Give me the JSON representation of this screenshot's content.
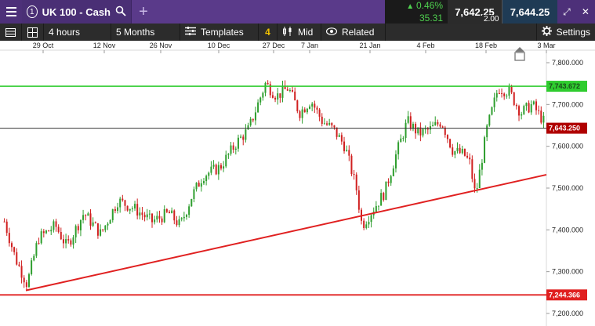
{
  "topbar": {
    "index_badge": "1",
    "instrument": "UK 100 - Cash",
    "change_pct": "0.46%",
    "change_pts": "35.31",
    "sell_price": "7,642.25",
    "buy_price": "7,644.25",
    "spread": "2.00",
    "colors": {
      "bg": "#5a3a8a",
      "up": "#4fd14f"
    }
  },
  "toolbar": {
    "interval": "4 hours",
    "range": "5 Months",
    "templates_label": "Templates",
    "templates_count": "4",
    "price_type": "Mid",
    "related_label": "Related",
    "settings_label": "Settings"
  },
  "chart": {
    "x_labels": [
      "29 Oct",
      "12 Nov",
      "26 Nov",
      "10 Dec",
      "27 Dec",
      "7 Jan",
      "21 Jan",
      "4 Feb",
      "18 Feb",
      "3 Mar"
    ],
    "y_labels": [
      "7,800.000",
      "7,700.000",
      "7,600.000",
      "7,500.000",
      "7,400.000",
      "7,300.000",
      "7,200.000"
    ],
    "resistance_tag": "7,743.672",
    "current_tag": "7,643.250",
    "support_tag": "7,244.366",
    "colors": {
      "up": "#2e9e2e",
      "down": "#d02020",
      "resistance": "#2ecc2e",
      "trend": "#e02020",
      "current": "#b00000"
    }
  },
  "chart_data": {
    "type": "candlestick",
    "instrument": "UK 100 - Cash",
    "interval": "4 hours",
    "ylim": [
      7180,
      7840
    ],
    "y_ticks": [
      7200,
      7300,
      7400,
      7500,
      7600,
      7700,
      7800
    ],
    "x_ticks": [
      "29 Oct",
      "12 Nov",
      "26 Nov",
      "10 Dec",
      "27 Dec",
      "7 Jan",
      "21 Jan",
      "4 Feb",
      "18 Feb",
      "3 Mar"
    ],
    "path": [
      [
        0,
        7420
      ],
      [
        0.02,
        7330
      ],
      [
        0.04,
        7270
      ],
      [
        0.06,
        7380
      ],
      [
        0.09,
        7410
      ],
      [
        0.11,
        7360
      ],
      [
        0.14,
        7440
      ],
      [
        0.17,
        7390
      ],
      [
        0.2,
        7470
      ],
      [
        0.23,
        7450
      ],
      [
        0.26,
        7420
      ],
      [
        0.29,
        7440
      ],
      [
        0.31,
        7410
      ],
      [
        0.33,
        7480
      ],
      [
        0.35,
        7530
      ],
      [
        0.38,
        7550
      ],
      [
        0.41,
        7610
      ],
      [
        0.43,
        7640
      ],
      [
        0.46,
        7750
      ],
      [
        0.48,
        7720
      ],
      [
        0.5,
        7740
      ],
      [
        0.52,
        7680
      ],
      [
        0.54,
        7710
      ],
      [
        0.56,
        7660
      ],
      [
        0.58,
        7640
      ],
      [
        0.6,
        7600
      ],
      [
        0.62,
        7500
      ],
      [
        0.63,
        7410
      ],
      [
        0.65,
        7450
      ],
      [
        0.67,
        7490
      ],
      [
        0.69,
        7580
      ],
      [
        0.71,
        7660
      ],
      [
        0.73,
        7630
      ],
      [
        0.75,
        7640
      ],
      [
        0.77,
        7660
      ],
      [
        0.79,
        7590
      ],
      [
        0.81,
        7580
      ],
      [
        0.82,
        7560
      ],
      [
        0.83,
        7480
      ],
      [
        0.85,
        7640
      ],
      [
        0.87,
        7740
      ],
      [
        0.89,
        7730
      ],
      [
        0.91,
        7680
      ],
      [
        0.93,
        7700
      ],
      [
        0.95,
        7660
      ],
      [
        0.97,
        7600
      ],
      [
        0.98,
        7610
      ],
      [
        1.0,
        7643
      ]
    ],
    "lines": [
      {
        "name": "resistance",
        "y": 7743.672
      },
      {
        "name": "current",
        "y": 7643.25
      },
      {
        "name": "support",
        "y": 7244.366
      },
      {
        "name": "trendline",
        "from": [
          "27 Oct",
          7255
        ],
        "to": [
          "3 Mar",
          7532
        ]
      }
    ]
  }
}
